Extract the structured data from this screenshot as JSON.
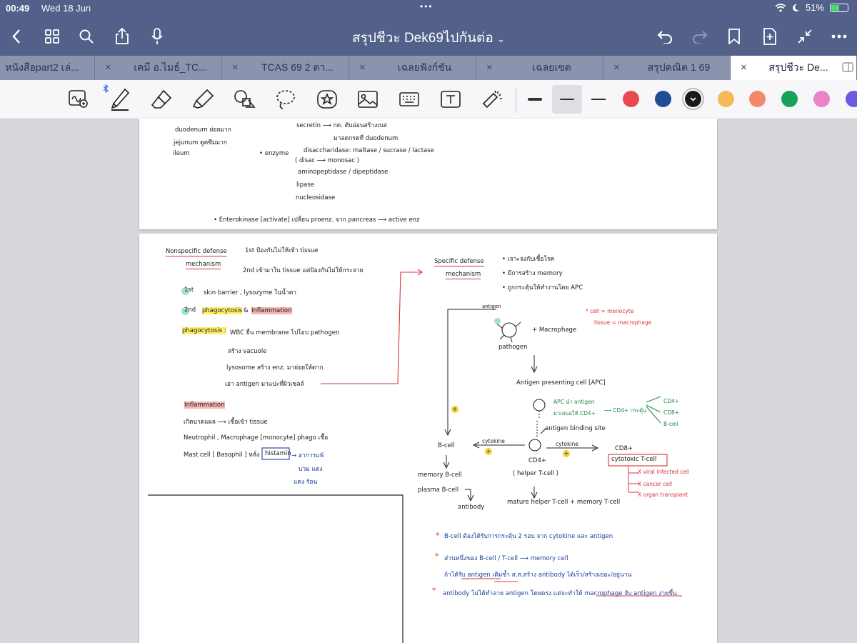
{
  "status": {
    "time": "00:49",
    "date": "Wed 18 Jun",
    "dots": "•••",
    "battery": "51%",
    "battery_level": 0.51
  },
  "toolbar": {
    "title": "สรุปชีวะ Dek69ไปกันต่อ",
    "title_chevron": "⌄"
  },
  "tabs": [
    {
      "label": "หนังสือpart2 เล่..."
    },
    {
      "label": "เคมี อ.ไมธ์_TC..."
    },
    {
      "label": "TCAS 69 2 ตา..."
    },
    {
      "label": "เฉลยฟังก์ชัน"
    },
    {
      "label": "เฉลยเซต"
    },
    {
      "label": "สรุปคณิต 1 69"
    },
    {
      "label": "สรุปชีวะ De..."
    }
  ],
  "tab_close": "×",
  "pen_colors": [
    "#e84a4f",
    "#1f4e96",
    "#1a1a1a",
    "#f7b85a",
    "#f4886a",
    "#18a15a",
    "#ea83c8",
    "#6a5be0"
  ],
  "page1": {
    "lines": [
      {
        "t": "duodenum ย่อยมาก"
      },
      {
        "t": "jejunum ดูดซึมมาก"
      },
      {
        "t": "ileum"
      },
      {
        "t": "secretin ⟶ กต. ตับอ่อนสร้างเบส"
      },
      {
        "t": "มาลดกรดที่ duodenum"
      },
      {
        "t": "• enzyme"
      },
      {
        "t": "disaccharidase: maltase / sucrase / lactase"
      },
      {
        "t": "( disac ⟶ monosac )"
      },
      {
        "t": "aminopeptidase / dipeptidase"
      },
      {
        "t": "lipase"
      },
      {
        "t": "nucleosidase"
      },
      {
        "t": "• Enterokinase [activate] เปลี่ยน proenz. จาก pancreas ⟶ active enz"
      }
    ]
  },
  "page2": {
    "left": [
      {
        "t": "Nonspecific defense"
      },
      {
        "t": "mechanism"
      },
      {
        "t": "1st ป้องกันไม่ให้เข้า tissue"
      },
      {
        "t": "2nd เข้ามาใน tissue แต่ป้องกันไม่ให้กระจาย"
      },
      {
        "t": "1st"
      },
      {
        "t": "skin barrier , lysozyme ในน้ำตา"
      },
      {
        "t": "2nd"
      },
      {
        "t": "phagocytosis"
      },
      {
        "t": "&"
      },
      {
        "t": "Inflammation"
      },
      {
        "t": "phagocytosis :"
      },
      {
        "t": "WBC ยื่น membrane ไปโอบ pathogen"
      },
      {
        "t": "สร้าง vacuole"
      },
      {
        "t": "lysosome สร้าง enz. มาย่อยให้ตาก"
      },
      {
        "t": "เอา antigen มาแปะที่ผิวเซลล์"
      },
      {
        "t": "Inflammation"
      },
      {
        "t": "เกิดบาดแผล ⟶ เชื้อเข้า tissue"
      },
      {
        "t": "Neutrophil , Macrophage [monocyte] phago เชื้อ"
      },
      {
        "t": "Mast cell [ Basophil ] หลั่ง"
      },
      {
        "t": "histamin"
      },
      {
        "t": "→ อาการแพ้"
      },
      {
        "t": "บวม แดง"
      },
      {
        "t": "แดง ร้อน"
      }
    ],
    "right": [
      {
        "t": "Specific defense"
      },
      {
        "t": "mechanism"
      },
      {
        "t": "• เจาะจงกับเชื้อโรค"
      },
      {
        "t": "• มีการสร้าง memory"
      },
      {
        "t": "• ถูกกระตุ้นให้ทำงานโดย APC"
      },
      {
        "t": "antigen"
      },
      {
        "t": "+ Macrophage"
      },
      {
        "t": "pathogen"
      },
      {
        "t": "* cell = monocyte"
      },
      {
        "t": "tissue = macrophage"
      },
      {
        "t": "Antigen presenting cell [APC]"
      },
      {
        "t": "APC นำ antigen"
      },
      {
        "t": "มาเสนอให้ CD4+"
      },
      {
        "t": "⟶ CD4+ กระตุ้น"
      },
      {
        "t": "CD4+"
      },
      {
        "t": "CD8+"
      },
      {
        "t": "B-cell"
      },
      {
        "t": "antigen binding site"
      },
      {
        "t": "cytokine"
      },
      {
        "t": "cytokine"
      },
      {
        "t": "B-cell"
      },
      {
        "t": "CD4+"
      },
      {
        "t": "( helper T-cell )"
      },
      {
        "t": "CD8+"
      },
      {
        "t": "cytotoxic T-cell"
      },
      {
        "t": "memory B-cell"
      },
      {
        "t": "plasma B-cell"
      },
      {
        "t": "antibody"
      },
      {
        "t": "mature helper T-cell + memory T-cell"
      },
      {
        "t": "X viral infected cell"
      },
      {
        "t": "X cancer cell"
      },
      {
        "t": "X organ transplant"
      },
      {
        "t": "*"
      },
      {
        "t": "B-cell ต้องได้รับการกระตุ้น 2 รอบ จาก cytokine และ antigen"
      },
      {
        "t": "*"
      },
      {
        "t": "ส่วนหนึ่งของ B-cell / T-cell ⟶ memory cell"
      },
      {
        "t": "ถ้าได้รับ antigen เดิมซ้ำ ส.ส.สร้าง antibody ได้เร็ว/สร้างเยอะ/อยู่นาน"
      },
      {
        "t": "*"
      },
      {
        "t": "antibody ไม่ได้ทำลาย antigen โดยตรง แต่จะทำให้ macrophage จับ antigen ง่ายขึ้น"
      }
    ]
  }
}
